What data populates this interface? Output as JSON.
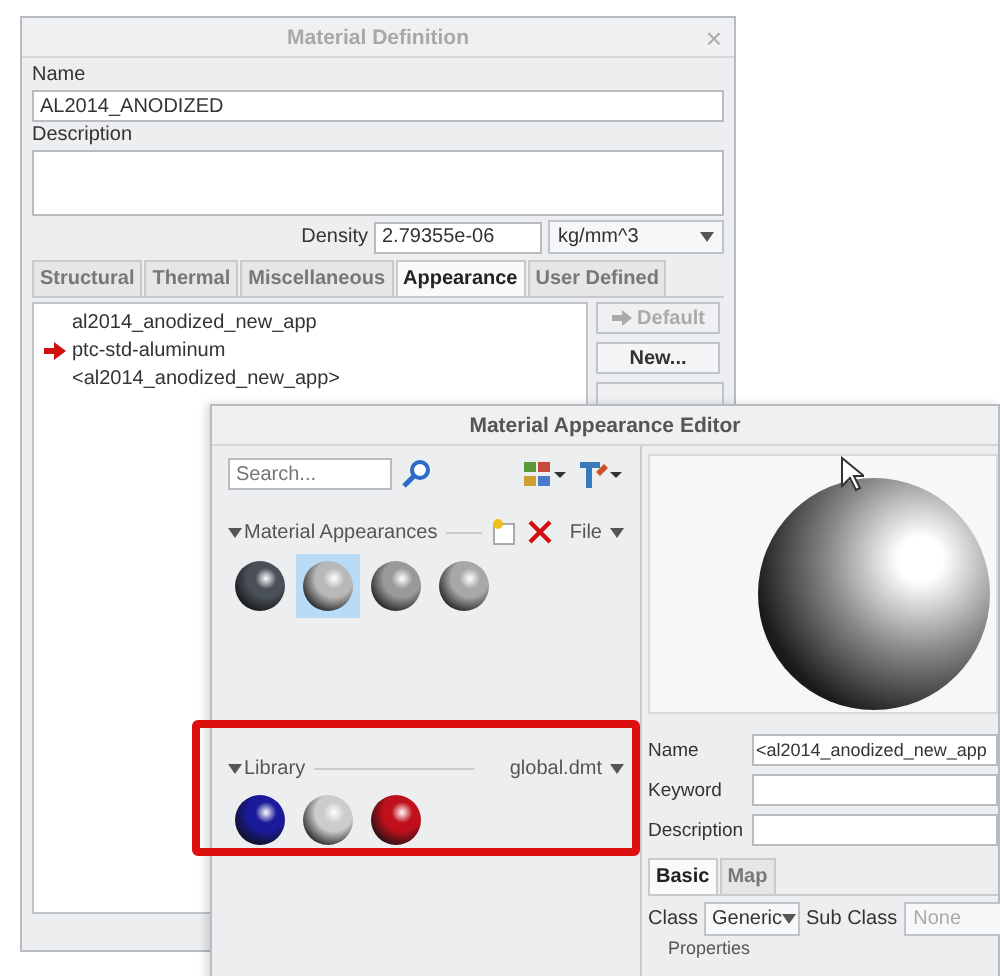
{
  "material_definition": {
    "title": "Material Definition",
    "close": "×",
    "name_label": "Name",
    "name_value": "AL2014_ANODIZED",
    "description_label": "Description",
    "density_label": "Density",
    "density_value": "2.79355e-06",
    "density_unit": "kg/mm^3",
    "tabs": [
      {
        "label": "Structural",
        "selected": false
      },
      {
        "label": "Thermal",
        "selected": false
      },
      {
        "label": "Miscellaneous",
        "selected": false
      },
      {
        "label": "Appearance",
        "selected": true
      },
      {
        "label": "User Defined",
        "selected": false
      }
    ],
    "appearances": [
      {
        "label": "al2014_anodized_new_app",
        "current": false
      },
      {
        "label": "ptc-std-aluminum",
        "current": true
      },
      {
        "label": "<al2014_anodized_new_app>",
        "current": false
      }
    ],
    "buttons": [
      {
        "label": "Default",
        "disabled": true
      },
      {
        "label": "New...",
        "disabled": false
      }
    ]
  },
  "appearance_editor": {
    "title": "Material Appearance Editor",
    "search": {
      "placeholder": "Search..."
    },
    "section_title": "Material Appearances",
    "file_menu": "File",
    "swatches": [
      {
        "color": "#4a5058",
        "selected": false
      },
      {
        "color": "#b8b8b8",
        "selected": true
      },
      {
        "color": "#9a9a9a",
        "selected": false
      },
      {
        "color": "#a8a8a8",
        "selected": false
      }
    ],
    "library": {
      "title": "Library",
      "file": "global.dmt",
      "swatches": [
        {
          "color": "#1a1a9a"
        },
        {
          "color": "#cccccc"
        },
        {
          "color": "#c0101c"
        }
      ]
    },
    "name_label": "Name",
    "name_value": "<al2014_anodized_new_app",
    "keyword_label": "Keyword",
    "description_label": "Description",
    "tabs": [
      {
        "label": "Basic",
        "selected": true
      },
      {
        "label": "Map",
        "selected": false
      }
    ],
    "class_label": "Class",
    "class_value": "Generic",
    "subclass_label": "Sub Class",
    "subclass_value": "None",
    "properties_label": "Properties"
  }
}
